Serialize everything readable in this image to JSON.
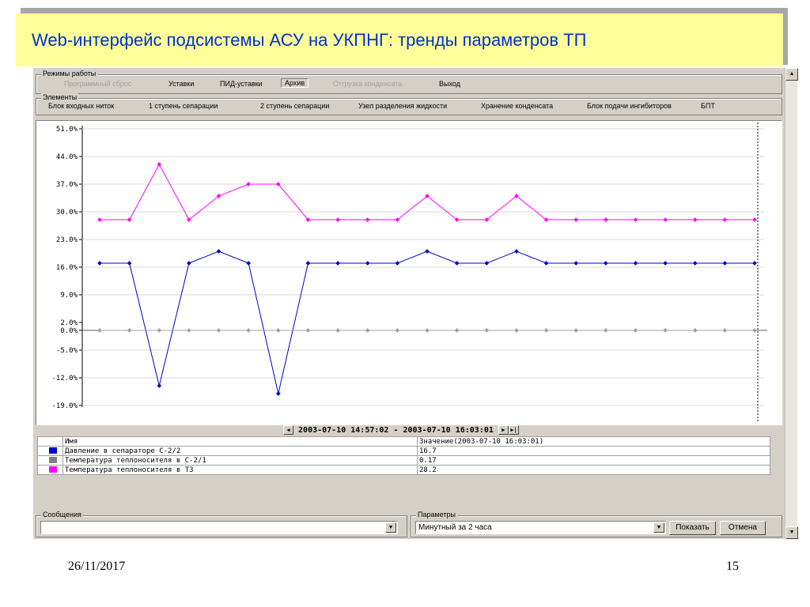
{
  "slide": {
    "title": "Web-интерфейс  подсистемы АСУ на УКПНГ: тренды параметров ТП",
    "date": "26/11/2017",
    "page_number": "15"
  },
  "modes": {
    "label": "Режимы работы",
    "items": [
      {
        "label": "Программный сброс",
        "state": "disabled"
      },
      {
        "label": "Уставки",
        "state": "normal"
      },
      {
        "label": "ПИД-уставки",
        "state": "normal"
      },
      {
        "label": "Архив",
        "state": "pressed"
      },
      {
        "label": "Отгрузка конденсата",
        "state": "disabled"
      },
      {
        "label": "Выход",
        "state": "normal"
      }
    ]
  },
  "elements": {
    "label": "Элементы",
    "items": [
      {
        "label": "Блок входных ниток"
      },
      {
        "label": "1 ступень сепарации"
      },
      {
        "label": "2 ступень сепарации"
      },
      {
        "label": "Узел разделения жидкости"
      },
      {
        "label": "Хранение конденсата"
      },
      {
        "label": "Блок подачи ингибиторов"
      },
      {
        "label": "БПТ"
      }
    ]
  },
  "navigation": {
    "prev_icon": "arrow-left-icon",
    "next_icon": "arrow-right-icon",
    "end_icon": "arrow-end-icon",
    "range": "2003-07-10 14:57:02 - 2003-07-10 16:03:01"
  },
  "legend": {
    "header_name": "Имя",
    "header_value": "Значение(2003-07-10 16:03:01)",
    "rows": [
      {
        "name": "Давление в сепараторе С-2/2",
        "value": "16.7",
        "color": "#0000cc"
      },
      {
        "name": "Температура теплоносителя в С-2/1",
        "value": "0.17",
        "color": "#808080"
      },
      {
        "name": "Температура теплоносителя в Т3",
        "value": "28.2",
        "color": "#ff00ff"
      }
    ]
  },
  "messages": {
    "label": "Сообщения",
    "value": ""
  },
  "parameters": {
    "label": "Параметры",
    "selected": "Минутный за 2 часа",
    "show_label": "Показать",
    "cancel_label": "Отмена"
  },
  "chart_data": {
    "type": "line",
    "yticks": [
      51,
      44,
      37,
      30,
      23,
      16,
      9,
      2,
      0,
      -5,
      -12,
      -19
    ],
    "ytick_labels": [
      "51.0%",
      "44.0%",
      "37.0%",
      "30.0%",
      "23.0%",
      "16.0%",
      "9.0%",
      "2.0%",
      "0.0%",
      "-5.0%",
      "-12.0%",
      "-19.0%"
    ],
    "ylim": [
      -19,
      51
    ],
    "grid": "horizontal",
    "points_count": 23,
    "series": [
      {
        "color": "#ff00ff",
        "values": [
          28,
          28,
          42,
          28,
          34,
          37,
          37,
          28,
          28,
          28,
          28,
          34,
          28,
          28,
          34,
          28,
          28,
          28,
          28,
          28,
          28,
          28,
          28
        ]
      },
      {
        "color": "#0000cc",
        "values": [
          17,
          17,
          -14,
          17,
          20,
          17,
          -16,
          17,
          17,
          17,
          17,
          20,
          17,
          17,
          20,
          17,
          17,
          17,
          17,
          17,
          17,
          17,
          17
        ]
      },
      {
        "color": "#a0a0a0",
        "values": [
          0,
          0,
          0,
          0,
          0,
          0,
          0,
          0,
          0,
          0,
          0,
          0,
          0,
          0,
          0,
          0,
          0,
          0,
          0,
          0,
          0,
          0,
          0
        ]
      }
    ]
  }
}
